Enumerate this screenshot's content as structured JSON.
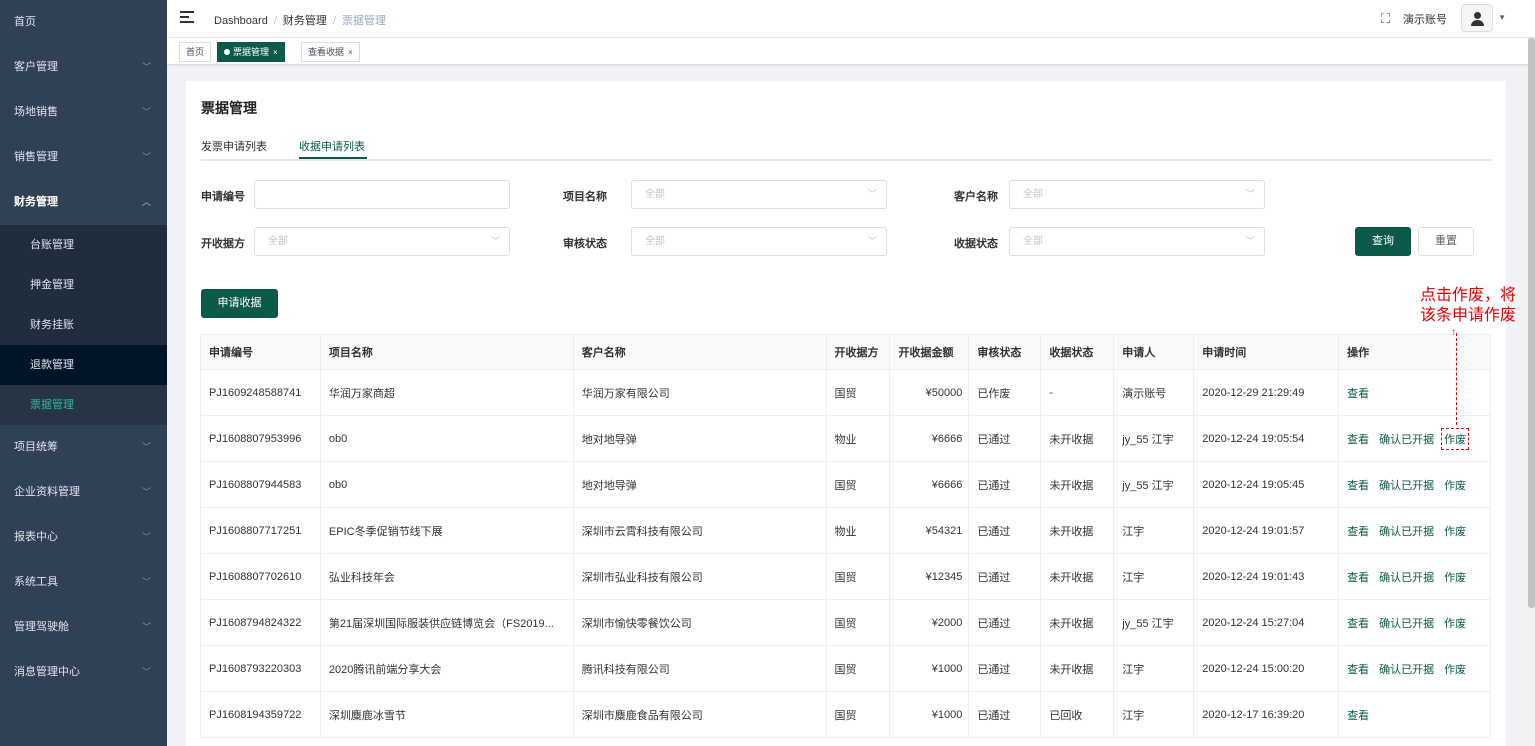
{
  "sidebar": {
    "items": [
      {
        "label": "首页",
        "chev": ""
      },
      {
        "label": "客户管理",
        "chev": "﹀"
      },
      {
        "label": "场地销售",
        "chev": "﹀"
      },
      {
        "label": "销售管理",
        "chev": "﹀"
      },
      {
        "label": "财务管理",
        "chev": "︿"
      },
      {
        "label": "项目统筹",
        "chev": "﹀"
      },
      {
        "label": "企业资料管理",
        "chev": "﹀"
      },
      {
        "label": "报表中心",
        "chev": "﹀"
      },
      {
        "label": "系统工具",
        "chev": "﹀"
      },
      {
        "label": "管理驾驶舱",
        "chev": "﹀"
      },
      {
        "label": "消息管理中心",
        "chev": "﹀"
      }
    ],
    "finance_sub": [
      "台账管理",
      "押金管理",
      "财务挂账",
      "退款管理",
      "票据管理"
    ]
  },
  "header": {
    "breadcrumb": [
      "Dashboard",
      "财务管理",
      "票据管理"
    ],
    "breadcrumb_sep": "/",
    "fullscreen_glyph": "⛶",
    "account": "演示账号",
    "caret": "▼"
  },
  "tags": {
    "items": [
      "首页",
      "票据管理",
      "查看收据"
    ],
    "close": "×"
  },
  "page": {
    "title": "票据管理",
    "tabs": [
      "发票申请列表",
      "收据申请列表"
    ]
  },
  "filters": {
    "apply_no_label": "申请编号",
    "project_label": "项目名称",
    "project_value": "全部",
    "customer_label": "客户名称",
    "customer_value": "全部",
    "issuer_label": "开收据方",
    "issuer_value": "全部",
    "audit_label": "审核状态",
    "audit_value": "全部",
    "receipt_label": "收据状态",
    "receipt_value": "全部",
    "arrow": "﹀"
  },
  "buttons": {
    "query": "查询",
    "reset": "重置",
    "apply": "申请收据"
  },
  "table": {
    "headers": [
      "申请编号",
      "项目名称",
      "客户名称",
      "开收据方",
      "开收据金额",
      "审核状态",
      "收据状态",
      "申请人",
      "申请时间",
      "操作"
    ],
    "rows": [
      {
        "no": "PJ1609248588741",
        "project": "华润万家商超",
        "customer": "华润万家有限公司",
        "issuer": "国贸",
        "amount": "¥50000",
        "audit": "已作废",
        "receipt": "-",
        "applicant": "演示账号",
        "time": "2020-12-29 21:29:49",
        "ops": [
          "查看"
        ]
      },
      {
        "no": "PJ1608807953996",
        "project": "ob0",
        "customer": "地对地导弹",
        "issuer": "物业",
        "amount": "¥6666",
        "audit": "已通过",
        "receipt": "未开收据",
        "applicant": "jy_55 江宇",
        "time": "2020-12-24 19:05:54",
        "ops": [
          "查看",
          "确认已开据",
          "作废"
        ]
      },
      {
        "no": "PJ1608807944583",
        "project": "ob0",
        "customer": "地对地导弹",
        "issuer": "国贸",
        "amount": "¥6666",
        "audit": "已通过",
        "receipt": "未开收据",
        "applicant": "jy_55 江宇",
        "time": "2020-12-24 19:05:45",
        "ops": [
          "查看",
          "确认已开据",
          "作废"
        ]
      },
      {
        "no": "PJ1608807717251",
        "project": "EPIC冬季促销节线下展",
        "customer": "深圳市云霄科技有限公司",
        "issuer": "物业",
        "amount": "¥54321",
        "audit": "已通过",
        "receipt": "未开收据",
        "applicant": "江宇",
        "time": "2020-12-24 19:01:57",
        "ops": [
          "查看",
          "确认已开据",
          "作废"
        ]
      },
      {
        "no": "PJ1608807702610",
        "project": "弘业科技年会",
        "customer": "深圳市弘业科技有限公司",
        "issuer": "国贸",
        "amount": "¥12345",
        "audit": "已通过",
        "receipt": "未开收据",
        "applicant": "江宇",
        "time": "2020-12-24 19:01:43",
        "ops": [
          "查看",
          "确认已开据",
          "作废"
        ]
      },
      {
        "no": "PJ1608794824322",
        "project": "第21届深圳国际服装供应链博览会（FS2019...",
        "customer": "深圳市愉快零餐饮公司",
        "issuer": "国贸",
        "amount": "¥2000",
        "audit": "已通过",
        "receipt": "未开收据",
        "applicant": "jy_55 江宇",
        "time": "2020-12-24 15:27:04",
        "ops": [
          "查看",
          "确认已开据",
          "作废"
        ]
      },
      {
        "no": "PJ1608793220303",
        "project": "2020腾讯前端分享大会",
        "customer": "腾讯科技有限公司",
        "issuer": "国贸",
        "amount": "¥1000",
        "audit": "已通过",
        "receipt": "未开收据",
        "applicant": "江宇",
        "time": "2020-12-24 15:00:20",
        "ops": [
          "查看",
          "确认已开据",
          "作废"
        ]
      },
      {
        "no": "PJ1608194359722",
        "project": "深圳麋鹿冰雪节",
        "customer": "深圳市麋鹿食品有限公司",
        "issuer": "国贸",
        "amount": "¥1000",
        "audit": "已通过",
        "receipt": "已回收",
        "applicant": "江宇",
        "time": "2020-12-17 16:39:20",
        "ops": [
          "查看"
        ]
      }
    ]
  },
  "annotation": {
    "line1": "点击作废，将",
    "line2": "该条申请作废",
    "arrow": "↑"
  },
  "colors": {
    "accent": "#0c5a4b",
    "sidebar_bg": "#304156",
    "annotation": "#e60000"
  }
}
